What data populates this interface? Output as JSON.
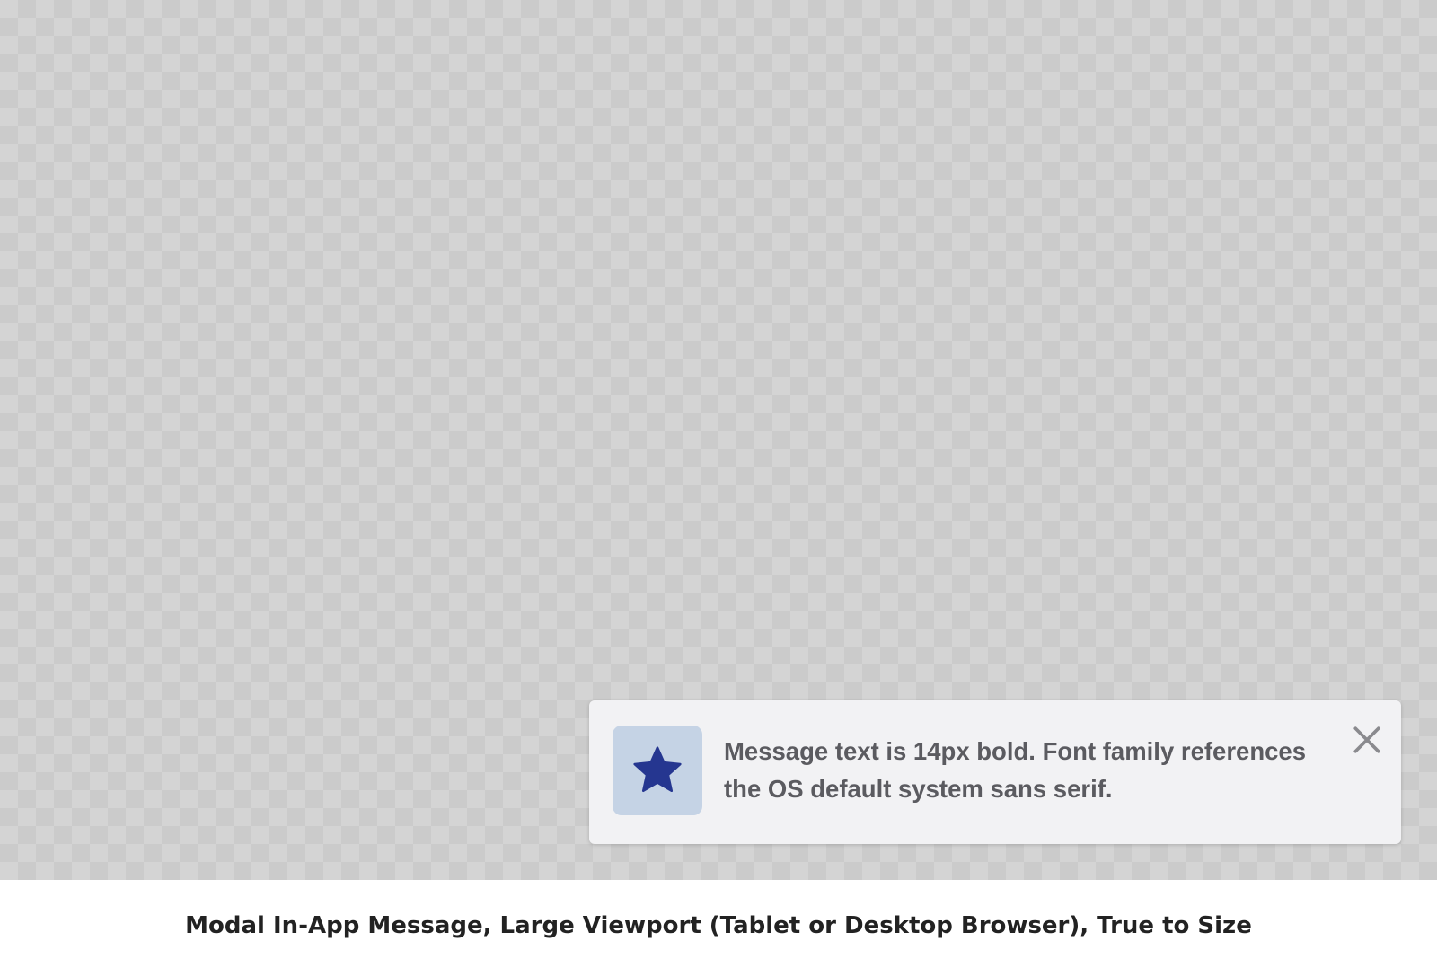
{
  "modal": {
    "message": "Message text is 14px bold. Font family references the OS default system sans serif.",
    "icon": "star-icon",
    "close_icon": "close-icon",
    "colors": {
      "background": "#f2f2f4",
      "icon_background": "#c5d3e5",
      "icon": "#253690",
      "text": "#5b5b60",
      "close": "#8a8a8e"
    }
  },
  "caption": "Modal In-App Message, Large Viewport (Tablet or Desktop Browser), True to Size"
}
